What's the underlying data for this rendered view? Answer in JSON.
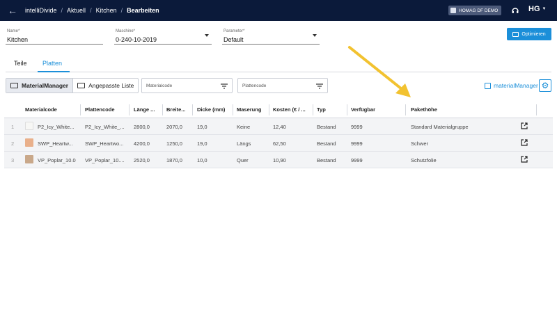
{
  "header": {
    "breadcrumb": [
      "intelliDivide",
      "Aktuell",
      "Kitchen",
      "Bearbeiten"
    ],
    "demo_label": "HOMAG DF DEMO",
    "logo": "HG",
    "icons": {
      "back": "arrow-left-icon",
      "building": "building-icon",
      "help": "headset-icon",
      "caret": "caret-down-icon"
    }
  },
  "form": {
    "name": {
      "label": "Name*",
      "value": "Kitchen"
    },
    "machine": {
      "label": "Maschine*",
      "value": "0-240-10-2019"
    },
    "parameter": {
      "label": "Parameter*",
      "value": "Default"
    },
    "optimize_label": "Optimieren"
  },
  "tabs": [
    {
      "label": "Teile"
    },
    {
      "label": "Platten",
      "active": true
    }
  ],
  "toolbar": {
    "seg_material_manager": "MaterialManager",
    "seg_custom_list": "Angepasste Liste",
    "filter_material_placeholder": "Materialcode",
    "filter_board_placeholder": "Plattencode",
    "material_manager_link": "materialManager"
  },
  "table": {
    "columns": [
      "Materialcode",
      "Plattencode",
      "Länge ...",
      "Breite...",
      "Dicke (mm)",
      "Maserung",
      "Kosten (€ / ...",
      "Typ",
      "Verfügbar",
      "Pakethöhe"
    ],
    "rows": [
      {
        "idx": "1",
        "material": "P2_Icy_White...",
        "board": "P2_Icy_White_...",
        "length": "2800,0",
        "width": "2070,0",
        "thickness": "19,0",
        "grain": "Keine",
        "cost": "12,40",
        "type": "Bestand",
        "available": "9999",
        "package": "Standard Materialgruppe",
        "swatch": "#f7f7f5"
      },
      {
        "idx": "2",
        "material": "SWP_Heartw...",
        "board": "SWP_Heartwo...",
        "length": "4200,0",
        "width": "1250,0",
        "thickness": "19,0",
        "grain": "Längs",
        "cost": "62,50",
        "type": "Bestand",
        "available": "9999",
        "package": "Schwer",
        "swatch": "#e9b08b"
      },
      {
        "idx": "3",
        "material": "VP_Poplar_10.0",
        "board": "VP_Poplar_10....",
        "length": "2520,0",
        "width": "1870,0",
        "thickness": "10,0",
        "grain": "Quer",
        "cost": "10,90",
        "type": "Bestand",
        "available": "9999",
        "package": "Schutzfolie",
        "swatch": "#c9a88a"
      }
    ]
  },
  "colors": {
    "topbar": "#0b1a3a",
    "accent": "#1b8fd9",
    "annotation_arrow": "#f2c230"
  }
}
